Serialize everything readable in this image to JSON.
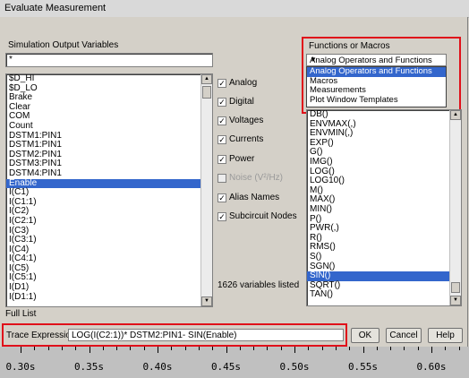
{
  "window": {
    "title": "Evaluate Measurement"
  },
  "simulation": {
    "section_label": "Simulation Output Variables",
    "filter_value": "*",
    "variables": [
      "$D_HI",
      "$D_LO",
      "Brake",
      "Clear",
      "COM",
      "Count",
      "DSTM1:PIN1",
      "DSTM1:PIN1",
      "DSTM2:PIN1",
      "DSTM3:PIN1",
      "DSTM4:PIN1",
      "Enable",
      "I(C1)",
      "I(C1:1)",
      "I(C2)",
      "I(C2:1)",
      "I(C3)",
      "I(C3:1)",
      "I(C4)",
      "I(C4:1)",
      "I(C5)",
      "I(C5:1)",
      "I(D1)",
      "I(D1:1)"
    ],
    "selected_variable": "Enable",
    "status": "1626 variables listed",
    "footer_label": "Full List"
  },
  "filters": [
    {
      "label": "Analog",
      "checked": true,
      "enabled": true
    },
    {
      "label": "Digital",
      "checked": true,
      "enabled": true
    },
    {
      "label": "Voltages",
      "checked": true,
      "enabled": true
    },
    {
      "label": "Currents",
      "checked": true,
      "enabled": true
    },
    {
      "label": "Power",
      "checked": true,
      "enabled": true
    },
    {
      "label": "Noise (V²/Hz)",
      "checked": false,
      "enabled": false
    },
    {
      "label": "Alias Names",
      "checked": true,
      "enabled": true
    },
    {
      "label": "Subcircuit Nodes",
      "checked": true,
      "enabled": true
    }
  ],
  "functions": {
    "section_label": "Functions or Macros",
    "dropdown_selected": "Analog Operators and Functions",
    "dropdown_options": [
      "Analog Operators and Functions",
      "Macros",
      "Measurements",
      "Plot Window Templates"
    ],
    "items": [
      "DB()",
      "ENVMAX(,)",
      "ENVMIN(,)",
      "EXP()",
      "G()",
      "IMG()",
      "LOG()",
      "LOG10()",
      "M()",
      "MAX()",
      "MIN()",
      "P()",
      "PWR(,)",
      "R()",
      "RMS()",
      "S()",
      "SGN()",
      "SIN()",
      "SQRT()",
      "TAN()"
    ],
    "selected_item": "SIN()"
  },
  "trace": {
    "label": "Trace Expression:",
    "value": "LOG(I(C2:1))* DSTM2:PIN1- SIN(Enable)"
  },
  "buttons": {
    "ok": "OK",
    "cancel": "Cancel",
    "help": "Help"
  },
  "axis": {
    "ticks": [
      "0.30s",
      "0.35s",
      "0.40s",
      "0.45s",
      "0.50s",
      "0.55s",
      "0.60s"
    ]
  },
  "highlight_color": "#e0101a",
  "selection_color": "#3366cc"
}
